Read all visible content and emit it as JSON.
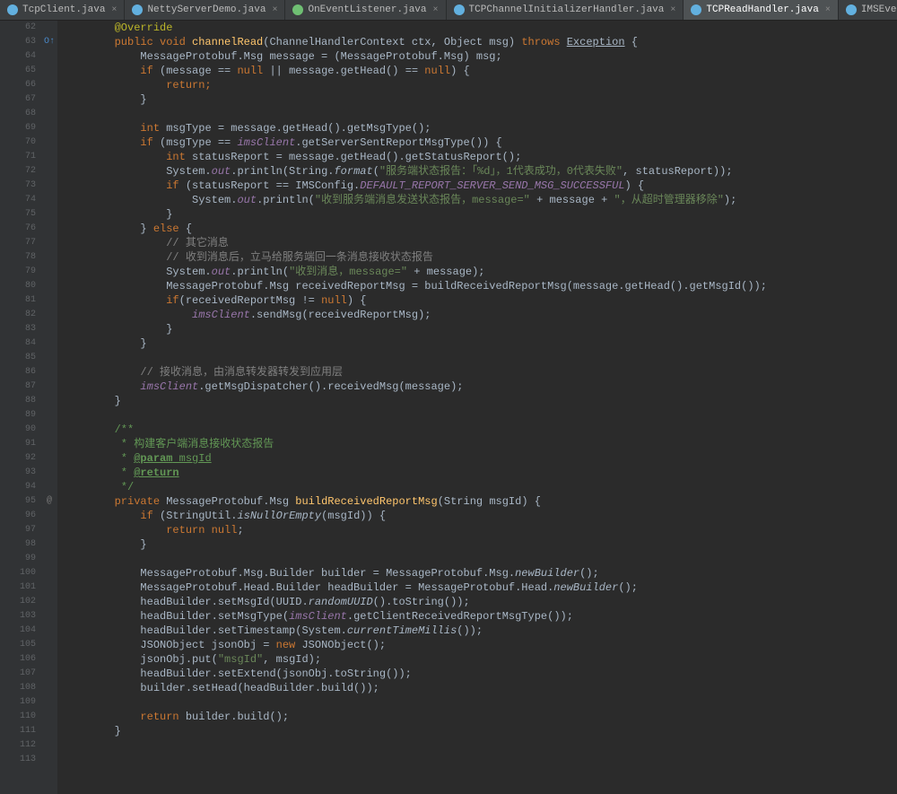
{
  "tabs": [
    {
      "label": "TcpClient.java",
      "icon": "ic-c",
      "active": false
    },
    {
      "label": "NettyServerDemo.java",
      "icon": "ic-c",
      "active": false
    },
    {
      "label": "OnEventListener.java",
      "icon": "ic-i",
      "active": false
    },
    {
      "label": "TCPChannelInitializerHandler.java",
      "icon": "ic-c",
      "active": false
    },
    {
      "label": "TCPReadHandler.java",
      "icon": "ic-c",
      "active": true
    },
    {
      "label": "IMSEventListener.java",
      "icon": "ic-c",
      "active": false
    }
  ],
  "lines": {
    "start": 62,
    "end": 113
  },
  "gutter_marks": {
    "63": "O↑",
    "95": "@"
  },
  "code": {
    "l62": "@Override",
    "l63_kw1": "public void",
    "l63_mn": "channelRead",
    "l63_rest": "(ChannelHandlerContext ctx, Object msg)",
    "l63_kw2": "throws",
    "l63_ex": "Exception",
    "l63_brace": " {",
    "l64": "MessageProtobuf.Msg message = (MessageProtobuf.Msg) msg;",
    "l65_kw": "if",
    "l65_rest": " (message == ",
    "l65_null1": "null",
    "l65_mid": " || message.getHead() == ",
    "l65_null2": "null",
    "l65_end": ") {",
    "l66": "return;",
    "l67": "}",
    "l69_kw": "int",
    "l69_rest": " msgType = message.getHead().getMsgType();",
    "l70_kw": "if",
    "l70_rest": " (msgType == ",
    "l70_fld": "imsClient",
    "l70_call": ".getServerSentReportMsgType()) {",
    "l71_kw": "int",
    "l71_rest": " statusReport = message.getHead().getStatusReport();",
    "l72_a": "System.",
    "l72_out": "out",
    "l72_b": ".println(String.",
    "l72_fmt": "format",
    "l72_c": "(",
    "l72_str": "\"服务端状态报告：「%d」，1代表成功，0代表失败\"",
    "l72_d": ", statusReport));",
    "l73_kw": "if",
    "l73_a": " (statusReport == IMSConfig.",
    "l73_fld": "DEFAULT_REPORT_SERVER_SEND_MSG_SUCCESSFUL",
    "l73_b": ") {",
    "l74_a": "System.",
    "l74_out": "out",
    "l74_b": ".println(",
    "l74_str": "\"收到服务端消息发送状态报告，message=\"",
    "l74_c": " + message + ",
    "l74_str2": "\"，从超时管理器移除\"",
    "l74_d": ");",
    "l75": "}",
    "l76_a": "} ",
    "l76_kw": "else",
    "l76_b": " {",
    "l77": "// 其它消息",
    "l78": "// 收到消息后，立马给服务端回一条消息接收状态报告",
    "l79_a": "System.",
    "l79_out": "out",
    "l79_b": ".println(",
    "l79_str": "\"收到消息，message=\"",
    "l79_c": " + message);",
    "l80": "MessageProtobuf.Msg receivedReportMsg = buildReceivedReportMsg(message.getHead().getMsgId());",
    "l81_kw": "if",
    "l81_a": "(receivedReportMsg != ",
    "l81_null": "null",
    "l81_b": ") {",
    "l82_fld": "imsClient",
    "l82_rest": ".sendMsg(receivedReportMsg);",
    "l83": "}",
    "l84": "}",
    "l86": "// 接收消息，由消息转发器转发到应用层",
    "l87_fld": "imsClient",
    "l87_rest": ".getMsgDispatcher().receivedMsg(message);",
    "l88": "}",
    "l90": "/**",
    "l91": " * 构建客户端消息接收状态报告",
    "l92_a": " * ",
    "l92_tag": "@param",
    "l92_b": " msgId",
    "l93_a": " * ",
    "l93_tag": "@return",
    "l94": " */",
    "l95_kw": "private",
    "l95_rest": " MessageProtobuf.Msg ",
    "l95_mn": "buildReceivedReportMsg",
    "l95_sig": "(String msgId) {",
    "l96_kw": "if",
    "l96_a": " (StringUtil.",
    "l96_stc": "isNullOrEmpty",
    "l96_b": "(msgId)) {",
    "l97_kw": "return null",
    "l97_b": ";",
    "l98": "}",
    "l100_a": "MessageProtobuf.Msg.Builder builder = MessageProtobuf.Msg.",
    "l100_stc": "newBuilder",
    "l100_b": "();",
    "l101_a": "MessageProtobuf.Head.Builder headBuilder = MessageProtobuf.Head.",
    "l101_stc": "newBuilder",
    "l101_b": "();",
    "l102_a": "headBuilder.setMsgId(UUID.",
    "l102_stc": "randomUUID",
    "l102_b": "().toString());",
    "l103_a": "headBuilder.setMsgType(",
    "l103_fld": "imsClient",
    "l103_b": ".getClientReceivedReportMsgType());",
    "l104_a": "headBuilder.setTimestamp(System.",
    "l104_stc": "currentTimeMillis",
    "l104_b": "());",
    "l105_a": "JSONObject jsonObj = ",
    "l105_kw": "new",
    "l105_b": " JSONObject();",
    "l106_a": "jsonObj.put(",
    "l106_str": "\"msgId\"",
    "l106_b": ", msgId);",
    "l107": "headBuilder.setExtend(jsonObj.toString());",
    "l108": "builder.setHead(headBuilder.build());",
    "l110_kw": "return",
    "l110_b": " builder.build();",
    "l111": "}"
  }
}
